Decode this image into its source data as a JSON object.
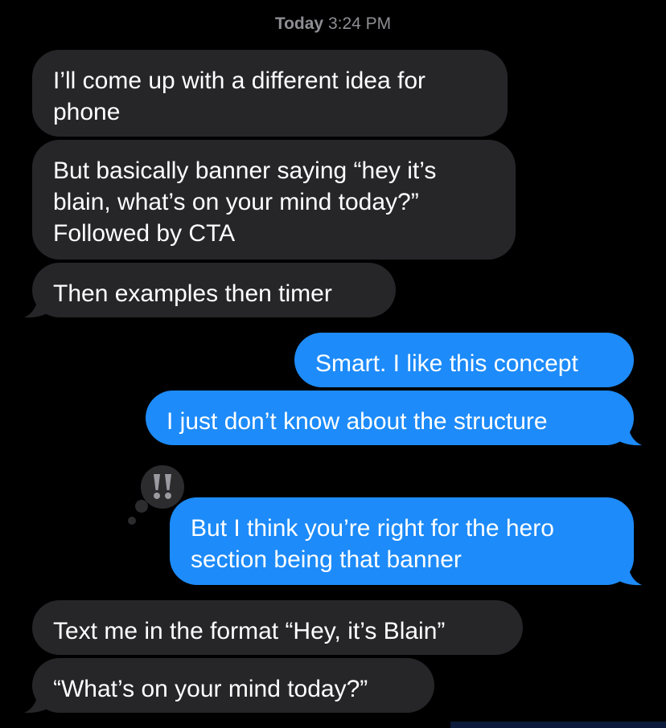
{
  "thread": {
    "timestamp_day": "Today",
    "timestamp_time": "3:24 PM",
    "colors": {
      "incoming": "#262629",
      "outgoing": "#1d8bf9",
      "timestamp": "#8e8e93"
    },
    "messages": [
      {
        "direction": "incoming",
        "lines": [
          "I’ll come up with a different idea for",
          "phone"
        ]
      },
      {
        "direction": "incoming",
        "lines": [
          "But basically banner saying “hey it’s",
          "blain, what’s on your mind today?”",
          "Followed by CTA"
        ]
      },
      {
        "direction": "incoming",
        "lines": [
          "Then examples then timer"
        ]
      },
      {
        "direction": "outgoing",
        "lines": [
          "Smart. I like this concept"
        ]
      },
      {
        "direction": "outgoing",
        "lines": [
          "I just don’t know about the structure"
        ]
      },
      {
        "direction": "outgoing",
        "lines": [
          "But I think you’re right for the hero",
          "section being that banner"
        ],
        "tapback": "double-exclamation-icon"
      },
      {
        "direction": "incoming",
        "lines": [
          "Text me in the format “Hey, it’s Blain”"
        ]
      },
      {
        "direction": "incoming",
        "lines": [
          "“What’s on your mind today?”"
        ]
      }
    ]
  }
}
